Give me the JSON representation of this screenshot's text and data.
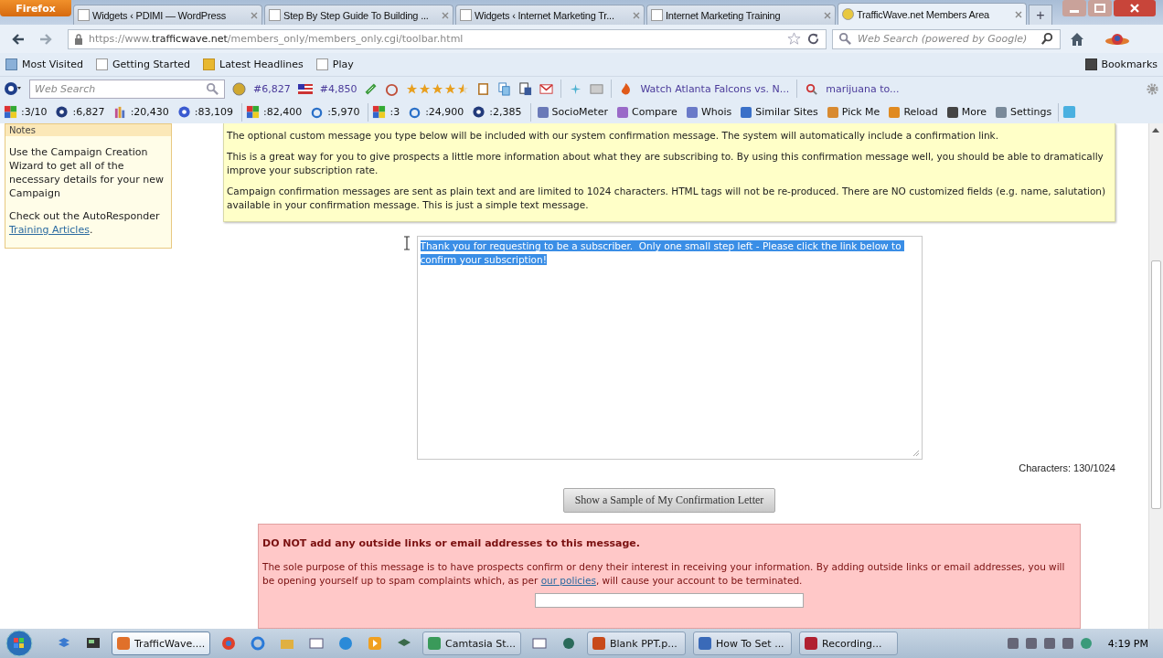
{
  "browser": {
    "firefox_button": "Firefox",
    "tabs": [
      {
        "title": "Widgets ‹ PDIMI — WordPress",
        "selected": false
      },
      {
        "title": "Step By Step Guide To Building ...",
        "selected": false
      },
      {
        "title": "Widgets ‹ Internet Marketing Tr...",
        "selected": false
      },
      {
        "title": "Internet Marketing Training",
        "selected": false
      },
      {
        "title": "TrafficWave.net Members Area",
        "selected": true
      }
    ],
    "new_tab": "+",
    "url": "https://www.**trafficwave.net**/members_only/members_only.cgi/toolbar.html",
    "search_placeholder": "Web Search (powered by Google)",
    "bookmarks": [
      "Most Visited",
      "Getting Started",
      "Latest Headlines",
      "Play"
    ],
    "bookmarks_menu": "Bookmarks"
  },
  "toolbar": {
    "search_placeholder": "Web Search",
    "rank_1": "#6,827",
    "rank_2": "#4,850",
    "stars": 4.5,
    "links": [
      "Watch Atlanta Falcons vs. N...",
      "marijuana to..."
    ]
  },
  "stats_bar": {
    "stats": [
      ":3/10",
      ":6,827",
      ":20,430",
      ":83,109",
      ":82,400",
      ":5,970",
      ":3",
      ":24,900",
      ":2,385"
    ],
    "buttons": [
      "SocioMeter",
      "Compare",
      "Whois",
      "Similar Sites",
      "Pick Me",
      "Reload",
      "More",
      "Settings"
    ]
  },
  "notes": {
    "title": "Notes",
    "text": "Use the Campaign Creation Wizard to get all of the necessary details for your new Campaign",
    "link_prefix": "Check out the AutoResponder",
    "link": "Training Articles",
    "link_suffix": "."
  },
  "info_box": {
    "paragraphs": [
      "The optional custom message you type below will be included with our system confirmation message. The system will automatically include a confirmation link.",
      "This is a great way for you to give prospects a little more information about what they are subscribing to. By using this confirmation message well, you should be able to dramatically improve your subscription rate.",
      "Campaign confirmation messages are sent as plain text and are limited to 1024 characters. HTML tags will not be re-produced. There are NO customized fields (e.g. name, salutation) available in your confirmation message. This is just a simple text message."
    ]
  },
  "message_field": {
    "value": "Thank you for requesting to be a subscriber.  Only one small step left - Please click the link below to confirm your subscription!",
    "selected": true
  },
  "char_count": "Characters: 130/1024",
  "sample_button": "Show a Sample of My Confirmation Letter",
  "warning_box": {
    "title": "DO NOT add any outside links or email addresses to this message.",
    "text_before": "The sole purpose of this message is to have prospects confirm or deny their interest in receiving your information. By adding outside links or email addresses, you will be opening yourself up to spam complaints which, as per",
    "link": "our policies",
    "text_after": ", will cause your account to be terminated."
  },
  "taskbar": {
    "tasks": [
      {
        "title": "TrafficWave....",
        "selected": true
      },
      {
        "title": "Camtasia St...",
        "selected": false
      },
      {
        "title": "Blank PPT.p...",
        "selected": false
      },
      {
        "title": "How To Set ...",
        "selected": false
      },
      {
        "title": "Recording...",
        "selected": false
      }
    ],
    "time": "4:19 PM"
  }
}
